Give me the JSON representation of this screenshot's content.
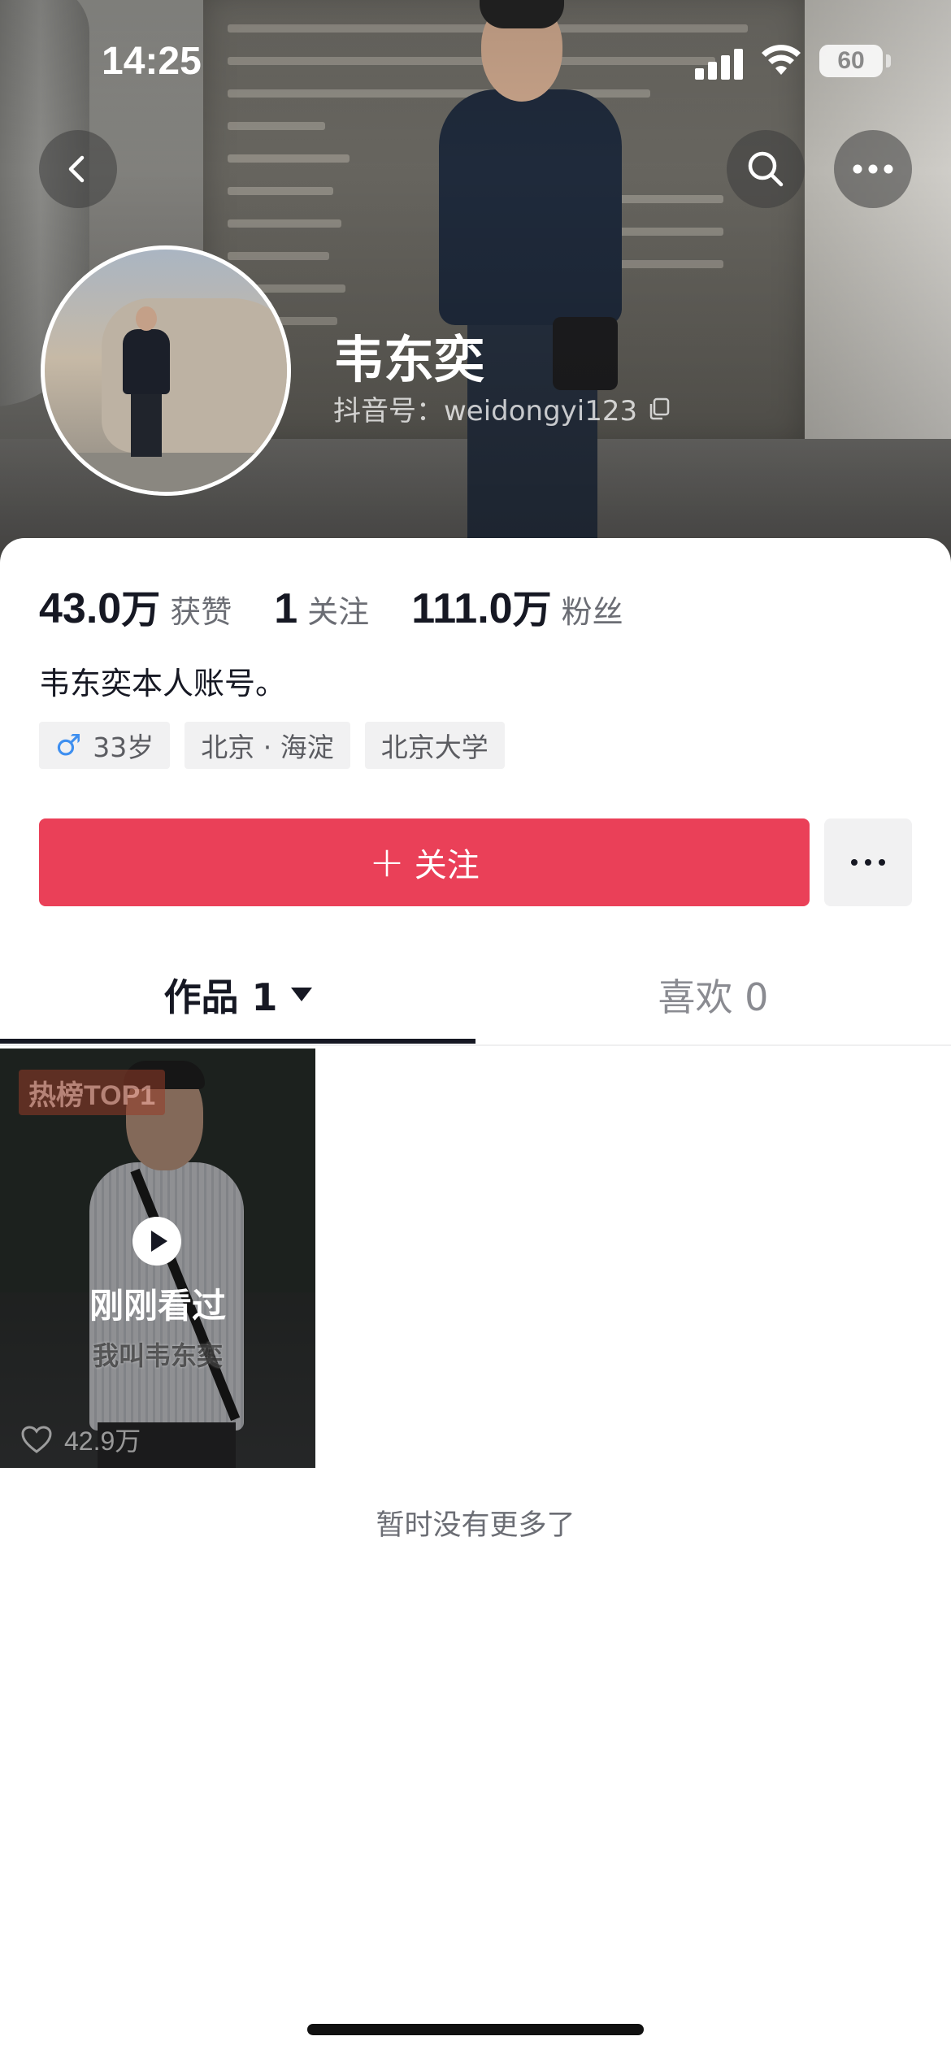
{
  "status_bar": {
    "time": "14:25",
    "battery": "60"
  },
  "nav": {
    "back_icon": "chevron-left-icon",
    "search_icon": "search-icon",
    "more_icon": "ellipsis-icon"
  },
  "profile": {
    "name": "韦东奕",
    "douyin_id": "抖音号：weidongyi123",
    "stats": [
      {
        "number": "43.0",
        "unit": "万",
        "label": "获赞"
      },
      {
        "number": "1",
        "unit": "",
        "label": "关注"
      },
      {
        "number": "111.0",
        "unit": "万",
        "label": "粉丝"
      }
    ],
    "bio": "韦东奕本人账号。",
    "tags": {
      "gender_symbol": "♂",
      "age": "33岁",
      "location": "北京 · 海淀",
      "school": "北京大学"
    }
  },
  "actions": {
    "follow_label": "关注",
    "follow_plus": "+",
    "more_label": "···"
  },
  "tabs": [
    {
      "label": "作品 1"
    },
    {
      "label": "喜欢 0"
    }
  ],
  "videos": [
    {
      "badge": "热榜TOP1",
      "watched": "刚刚看过",
      "caption": "我叫韦东奕",
      "likes": "42.9万"
    }
  ],
  "footer": {
    "no_more": "暂时没有更多了"
  },
  "colors": {
    "follow_button": "#ea4058",
    "text_primary": "#161823",
    "text_secondary": "#6b6d74",
    "tag_background": "#f1f1f2",
    "male_symbol": "#3e8ff0"
  }
}
